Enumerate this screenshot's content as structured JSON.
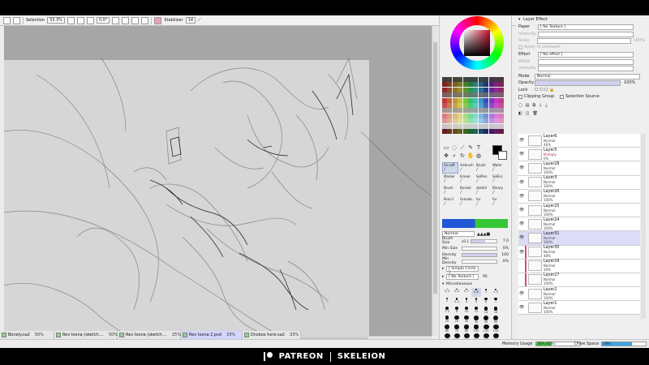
{
  "toolbar": {
    "selection_label": "Selection",
    "zoom": "33.3%",
    "rotation": "0.0°",
    "stabilizer_label": "Stabilizer",
    "stabilizer_value": "14"
  },
  "canvas": {
    "description_colors": {
      "paper": "#d6d6d6",
      "background": "#a6a6a6"
    }
  },
  "tools": {
    "brushes": [
      {
        "label": "Air.soft"
      },
      {
        "label": "Airbrush"
      },
      {
        "label": "Brush"
      },
      {
        "label": "Water"
      },
      {
        "label": "Marker"
      },
      {
        "label": "Eraser"
      },
      {
        "label": "SelPen"
      },
      {
        "label": "SelErs"
      },
      {
        "label": "Brush"
      },
      {
        "label": "Bucket"
      },
      {
        "label": "sketch"
      },
      {
        "label": "Binary"
      },
      {
        "label": "Pencil"
      },
      {
        "label": "Greada..."
      },
      {
        "label": "fur"
      },
      {
        "label": "fur"
      }
    ],
    "active_brush_index": 0,
    "mode": "Normal",
    "brush_size_label": "Brush Size",
    "brush_size_multiplier": "x0.1",
    "brush_size_value": "7.0",
    "min_size_label": "Min Size",
    "min_size_value": "0%",
    "density_label": "Density",
    "density_value": "100",
    "min_density_label": "Min Density",
    "min_density_value": "0%",
    "shape": "[ Simple Circle ]",
    "texture": "[ No Texture ]",
    "texture_amount": "95",
    "misc_label": "Miscellaneous",
    "sizes": [
      "0.3",
      "0.4",
      "0.7",
      "0.8",
      "1",
      "1.3",
      "2",
      "2.3",
      "4",
      "5",
      "6",
      "7",
      "7.5",
      "8",
      "10",
      "12",
      "14",
      "16",
      "20",
      "25",
      "30",
      "35",
      "40",
      "50",
      "60",
      "70",
      "80",
      "100",
      "120",
      "150",
      "200",
      "250",
      "300",
      "350",
      "400",
      "500"
    ],
    "selected_size_index": 3
  },
  "layer_panel": {
    "layer_effect_label": "Layer Effect",
    "paper_label": "Paper",
    "paper_value": "[ No Texture ]",
    "intensity_label": "Intensity",
    "scale_label": "Scale",
    "scale_value": "100%",
    "apply_label": "Apply to Linework",
    "effect_label": "Effect",
    "effect_value": "[ No effect ]",
    "width_label": "Width",
    "intensity2_label": "Intensity",
    "mode_label": "Mode",
    "mode_value": "Normal",
    "opacity_label": "Opacity",
    "opacity_value": "100%",
    "lock_label": "Lock",
    "clipping_label": "Clipping Group",
    "selection_source_label": "Selection Source",
    "layers": [
      {
        "name": "Layer6",
        "mode": "Normal",
        "opacity": "46%",
        "selected": false,
        "visible": true,
        "clip": false
      },
      {
        "name": "Layer5",
        "mode": "Multiply",
        "opacity": "0%",
        "selected": false,
        "visible": true,
        "clip": false
      },
      {
        "name": "Layer28",
        "mode": "Normal",
        "opacity": "100%",
        "selected": false,
        "visible": true,
        "clip": false
      },
      {
        "name": "Layer3",
        "mode": "Normal",
        "opacity": "100%",
        "selected": false,
        "visible": true,
        "clip": false
      },
      {
        "name": "Layer26",
        "mode": "Normal",
        "opacity": "100%",
        "selected": false,
        "visible": true,
        "clip": false
      },
      {
        "name": "Layer25",
        "mode": "Normal",
        "opacity": "100%",
        "selected": false,
        "visible": true,
        "clip": false
      },
      {
        "name": "Layer24",
        "mode": "Normal",
        "opacity": "100%",
        "selected": false,
        "visible": true,
        "clip": false
      },
      {
        "name": "Layer31",
        "mode": "Normal",
        "opacity": "100%",
        "selected": true,
        "visible": true,
        "clip": false
      },
      {
        "name": "Layer30",
        "mode": "Normal",
        "opacity": "48%",
        "selected": false,
        "visible": true,
        "clip": true
      },
      {
        "name": "Layer29",
        "mode": "Normal",
        "opacity": "19%",
        "selected": false,
        "visible": false,
        "clip": true
      },
      {
        "name": "Layer27",
        "mode": "Normal",
        "opacity": "100%",
        "selected": false,
        "visible": false,
        "clip": true
      },
      {
        "name": "Layer2",
        "mode": "Normal",
        "opacity": "100%",
        "selected": false,
        "visible": true,
        "clip": false
      },
      {
        "name": "Layer1",
        "mode": "Normal",
        "opacity": "100%",
        "selected": false,
        "visible": true,
        "clip": false
      }
    ]
  },
  "tabs": [
    {
      "name": "Bonely.sa2",
      "pct": "50%",
      "active": false
    },
    {
      "name": "Rev Ioona (sketch....",
      "pct": "50%",
      "active": false
    },
    {
      "name": "Rev Ioona (sketch....",
      "pct": "25%",
      "active": false
    },
    {
      "name": "Rev Ioona 2.psd",
      "pct": "33%",
      "active": true
    },
    {
      "name": "Dnsbox here.sa2",
      "pct": "33%",
      "active": false
    }
  ],
  "status": {
    "memory_label": "Memory Usage",
    "memory_value": "36% (42%)",
    "memory_fraction": 0.36,
    "drive_label": "Drive Space",
    "drive_value": "69%",
    "drive_fraction": 0.69,
    "memory_color": "#3cc83c",
    "drive_color": "#3aa7e8"
  },
  "footer": {
    "left_text": "PATREON",
    "right_text": "SKELEION"
  }
}
